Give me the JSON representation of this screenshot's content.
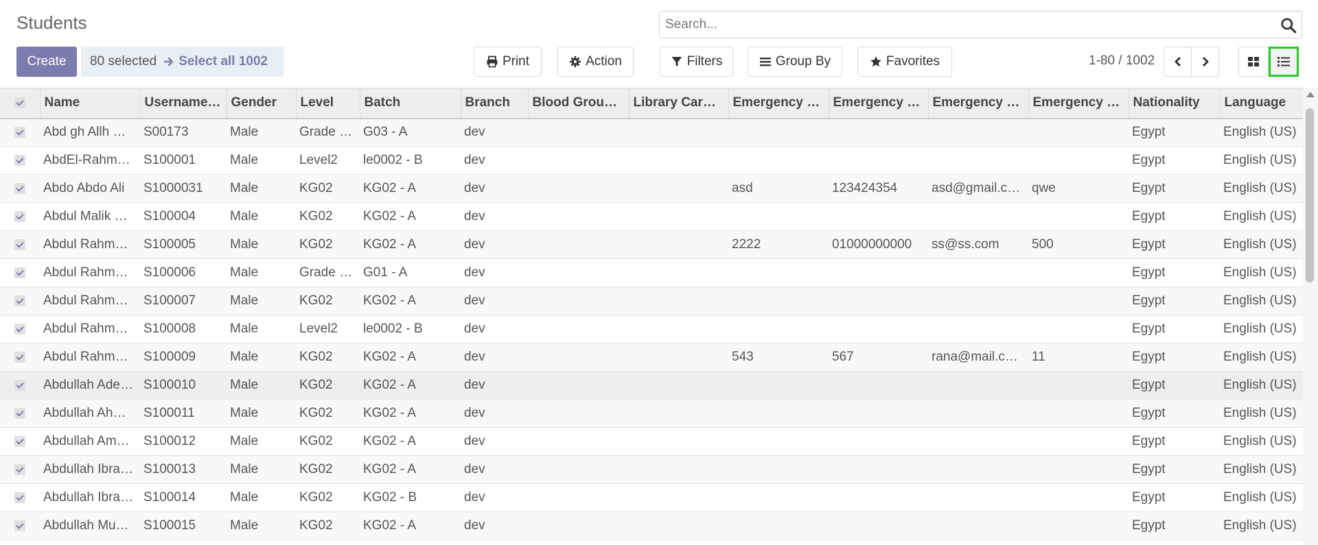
{
  "title": "Students",
  "search": {
    "placeholder": "Search..."
  },
  "buttons": {
    "create": "Create",
    "print": "Print",
    "action": "Action",
    "filters": "Filters",
    "group_by": "Group By",
    "favorites": "Favorites"
  },
  "selection": {
    "selected_text": "80 selected",
    "select_all": "Select all 1002"
  },
  "pager": {
    "value": "1-80 / 1002"
  },
  "colors": {
    "primary": "#7c7bad",
    "highlight_border": "#22cc22"
  },
  "columns": [
    "Name",
    "Username…",
    "Gender",
    "Level",
    "Batch",
    "Branch",
    "Blood Grou…",
    "Library Car…",
    "Emergency …",
    "Emergency …",
    "Emergency …",
    "Emergency …",
    "Nationality",
    "Language"
  ],
  "rows": [
    [
      "Abd gh Allh …",
      "S00173",
      "Male",
      "Grade …",
      "G03 - A",
      "dev",
      "",
      "",
      "",
      "",
      "",
      "",
      "Egypt",
      "English (US)"
    ],
    [
      "AbdEl-Rahm…",
      "S100001",
      "Male",
      "Level2",
      "le0002 - B",
      "dev",
      "",
      "",
      "",
      "",
      "",
      "",
      "Egypt",
      "English (US)"
    ],
    [
      "Abdo Abdo Ali",
      "S1000031",
      "Male",
      "KG02",
      "KG02 - A",
      "dev",
      "",
      "",
      "asd",
      "123424354",
      "asd@gmail.c…",
      "qwe",
      "Egypt",
      "English (US)"
    ],
    [
      "Abdul Malik …",
      "S100004",
      "Male",
      "KG02",
      "KG02 - A",
      "dev",
      "",
      "",
      "",
      "",
      "",
      "",
      "Egypt",
      "English (US)"
    ],
    [
      "Abdul Rahm…",
      "S100005",
      "Male",
      "KG02",
      "KG02 - A",
      "dev",
      "",
      "",
      "2222",
      "01000000000",
      "ss@ss.com",
      "500",
      "Egypt",
      "English (US)"
    ],
    [
      "Abdul Rahm…",
      "S100006",
      "Male",
      "Grade …",
      "G01 - A",
      "dev",
      "",
      "",
      "",
      "",
      "",
      "",
      "Egypt",
      "English (US)"
    ],
    [
      "Abdul Rahm…",
      "S100007",
      "Male",
      "KG02",
      "KG02 - A",
      "dev",
      "",
      "",
      "",
      "",
      "",
      "",
      "Egypt",
      "English (US)"
    ],
    [
      "Abdul Rahm…",
      "S100008",
      "Male",
      "Level2",
      "le0002 - B",
      "dev",
      "",
      "",
      "",
      "",
      "",
      "",
      "Egypt",
      "English (US)"
    ],
    [
      "Abdul Rahm…",
      "S100009",
      "Male",
      "KG02",
      "KG02 - A",
      "dev",
      "",
      "",
      "543",
      "567",
      "rana@mail.c…",
      "11",
      "Egypt",
      "English (US)"
    ],
    [
      "Abdullah Ade…",
      "S100010",
      "Male",
      "KG02",
      "KG02 - A",
      "dev",
      "",
      "",
      "",
      "",
      "",
      "",
      "Egypt",
      "English (US)"
    ],
    [
      "Abdullah Ah…",
      "S100011",
      "Male",
      "KG02",
      "KG02 - A",
      "dev",
      "",
      "",
      "",
      "",
      "",
      "",
      "Egypt",
      "English (US)"
    ],
    [
      "Abdullah Am…",
      "S100012",
      "Male",
      "KG02",
      "KG02 - A",
      "dev",
      "",
      "",
      "",
      "",
      "",
      "",
      "Egypt",
      "English (US)"
    ],
    [
      "Abdullah Ibra…",
      "S100013",
      "Male",
      "KG02",
      "KG02 - A",
      "dev",
      "",
      "",
      "",
      "",
      "",
      "",
      "Egypt",
      "English (US)"
    ],
    [
      "Abdullah Ibra…",
      "S100014",
      "Male",
      "KG02",
      "KG02 - B",
      "dev",
      "",
      "",
      "",
      "",
      "",
      "",
      "Egypt",
      "English (US)"
    ],
    [
      "Abdullah Mu…",
      "S100015",
      "Male",
      "KG02",
      "KG02 - A",
      "dev",
      "",
      "",
      "",
      "",
      "",
      "",
      "Egypt",
      "English (US)"
    ]
  ],
  "icons": {
    "search": "search-icon",
    "print": "print-icon",
    "action": "gear-icon",
    "filters": "filter-icon",
    "group_by": "bars-icon",
    "favorites": "star-icon",
    "select_all": "arrow-right-icon",
    "prev": "chevron-left-icon",
    "next": "chevron-right-icon",
    "kanban": "kanban-view-icon",
    "list": "list-view-icon"
  }
}
